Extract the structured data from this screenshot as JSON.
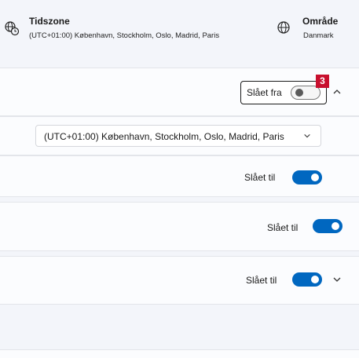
{
  "header": {
    "timezone": {
      "title": "Tidszone",
      "value": "(UTC+01:00) København, Stockholm, Oslo, Madrid, Paris"
    },
    "region": {
      "title": "Område",
      "value": "Danmark"
    }
  },
  "settings": {
    "auto_time": {
      "state_label": "Slået fra",
      "toggle_on": false,
      "badge": "3"
    },
    "timezone_select": {
      "selected": "(UTC+01:00) København, Stockholm, Oslo, Madrid, Paris"
    },
    "row2": {
      "state_label": "Slået til",
      "toggle_on": true
    },
    "row3": {
      "state_label": "Slået til",
      "toggle_on": true
    },
    "row4": {
      "state_label": "Slået til",
      "toggle_on": true
    }
  },
  "colors": {
    "accent": "#0067c0",
    "badge": "#c8102e"
  }
}
